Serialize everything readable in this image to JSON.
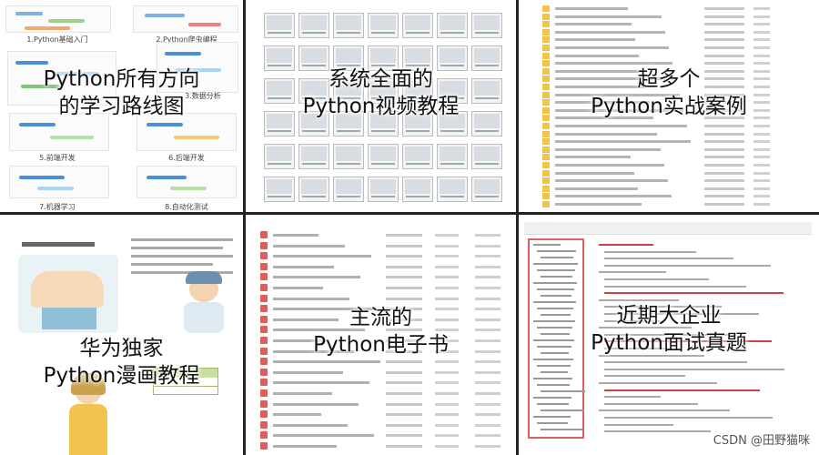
{
  "panels": [
    {
      "caption": [
        "Python所有方向",
        "的学习路线图"
      ],
      "mindmap_labels": [
        "1.Python基础入门",
        "2.Python爬虫编程",
        "3.数据分析",
        "5.前端开发",
        "6.后端开发",
        "7.机器学习",
        "8.自动化测试"
      ]
    },
    {
      "caption": [
        "系统全面的",
        "Python视频教程"
      ]
    },
    {
      "caption": [
        "超多个",
        "Python实战案例"
      ]
    },
    {
      "caption": [
        "华为独家",
        "Python漫画教程"
      ]
    },
    {
      "caption": [
        "主流的",
        "Python电子书"
      ]
    },
    {
      "caption": [
        "近期大企业",
        "Python面试真题"
      ]
    }
  ],
  "watermark": "CSDN @田野猫咪",
  "colors": {
    "border": "#222222",
    "caption_text": "#111111",
    "folder_icon": "#f2c24b",
    "pdf_icon": "#e25b5b"
  }
}
